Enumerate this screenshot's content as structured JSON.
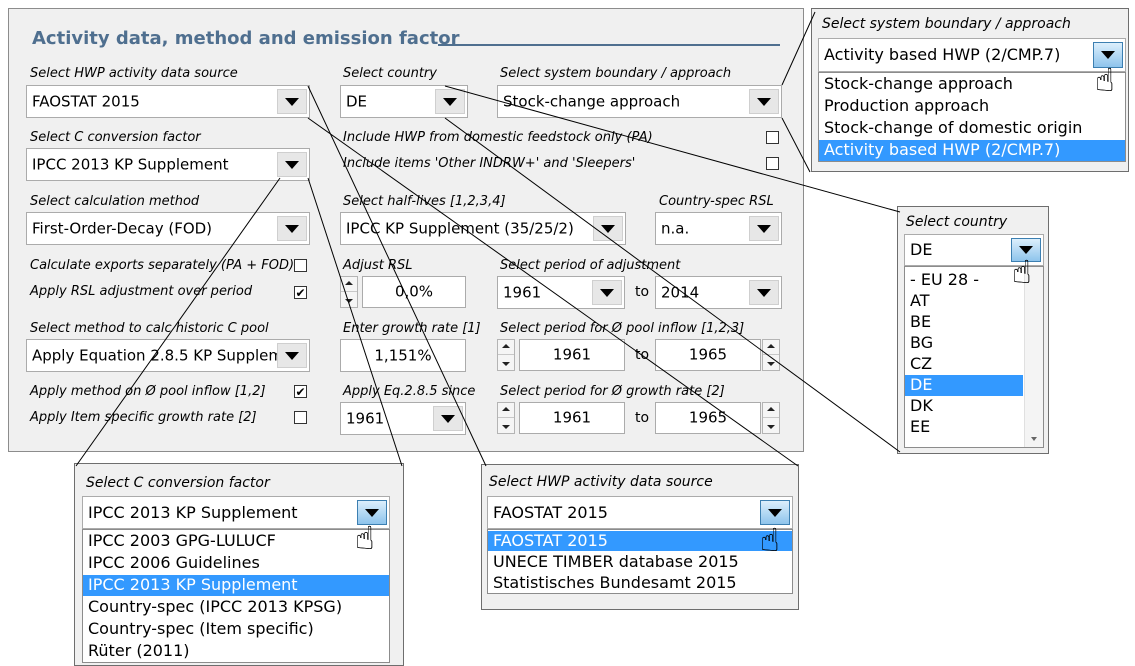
{
  "main": {
    "title": "Activity data, method and emission factor",
    "hwp_source": {
      "label": "Select HWP activity data source",
      "value": "FAOSTAT 2015"
    },
    "country": {
      "label": "Select country",
      "value": "DE"
    },
    "boundary": {
      "label": "Select system boundary / approach",
      "value": "Stock-change approach"
    },
    "c_conversion": {
      "label": "Select C conversion factor",
      "value": "IPCC 2013 KP Supplement"
    },
    "domestic_only": {
      "label": "Include HWP from domestic feedstock only (PA)",
      "checked": false
    },
    "other_items": {
      "label": "Include items 'Other INDRW+' and 'Sleepers'",
      "checked": false
    },
    "calc_method": {
      "label": "Select calculation method",
      "value": "First-Order-Decay (FOD)"
    },
    "half_lives": {
      "label": "Select half-lives [1,2,3,4]",
      "value": "IPCC KP Supplement (35/25/2)"
    },
    "country_rsl": {
      "label": "Country-spec RSL",
      "value": "n.a."
    },
    "exports_sep": {
      "label": "Calculate exports separately (PA + FOD)",
      "checked": false
    },
    "rsl_adjust": {
      "label": "Apply RSL adjustment over period",
      "checked": true
    },
    "adjust_rsl": {
      "label": "Adjust RSL",
      "value": "0,0%"
    },
    "period_adjust": {
      "label": "Select period of adjustment",
      "from": "1961",
      "to_label": "to",
      "to": "2014"
    },
    "historic_pool": {
      "label": "Select method to calc historic C pool",
      "value": "Apply Equation 2.8.5 KP Supplem"
    },
    "growth_rate": {
      "label": "Enter growth rate [1]",
      "value": "1,151%"
    },
    "period_inflow": {
      "label": "Select period for Ø pool inflow [1,2,3]",
      "from": "1961",
      "to_label": "to",
      "to": "1965"
    },
    "method_inflow": {
      "label": "Apply method on Ø pool inflow [1,2]",
      "checked": true
    },
    "item_growth": {
      "label": "Apply Item specific growth rate [2]",
      "checked": false
    },
    "eq_since": {
      "label": "Apply Eq.2.8.5 since",
      "value": "1961"
    },
    "period_growth": {
      "label": "Select period for Ø growth rate [2]",
      "from": "1961",
      "to_label": "to",
      "to": "1965"
    }
  },
  "popup_boundary": {
    "label": "Select system boundary / approach",
    "value": "Activity based HWP (2/CMP.7)",
    "options": [
      "Stock-change approach",
      "Production approach",
      "Stock-change of domestic origin",
      "Activity based HWP (2/CMP.7)"
    ]
  },
  "popup_country": {
    "label": "Select country",
    "value": "DE",
    "options": [
      "- EU 28 -",
      "AT",
      "BE",
      "BG",
      "CZ",
      "DE",
      "DK",
      "EE"
    ]
  },
  "popup_cconv": {
    "label": "Select C conversion factor",
    "value": "IPCC 2013 KP Supplement",
    "options": [
      "IPCC 2003 GPG-LULUCF",
      "IPCC 2006 Guidelines",
      "IPCC 2013 KP Supplement",
      "Country-spec (IPCC 2013 KPSG)",
      "Country-spec (Item specific)",
      "Rüter (2011)"
    ]
  },
  "popup_hwp": {
    "label": "Select HWP activity data source",
    "value": "FAOSTAT 2015",
    "options": [
      "FAOSTAT 2015",
      "UNECE TIMBER database 2015",
      "Statistisches Bundesamt 2015"
    ]
  },
  "icons": {
    "dropdown": "chevron-down-icon",
    "cursor": "hand-pointer-icon",
    "check": "checkmark-icon"
  },
  "colors": {
    "title": "#4f6f8f",
    "selection": "#3399ff",
    "panel": "#f0f0f0"
  }
}
